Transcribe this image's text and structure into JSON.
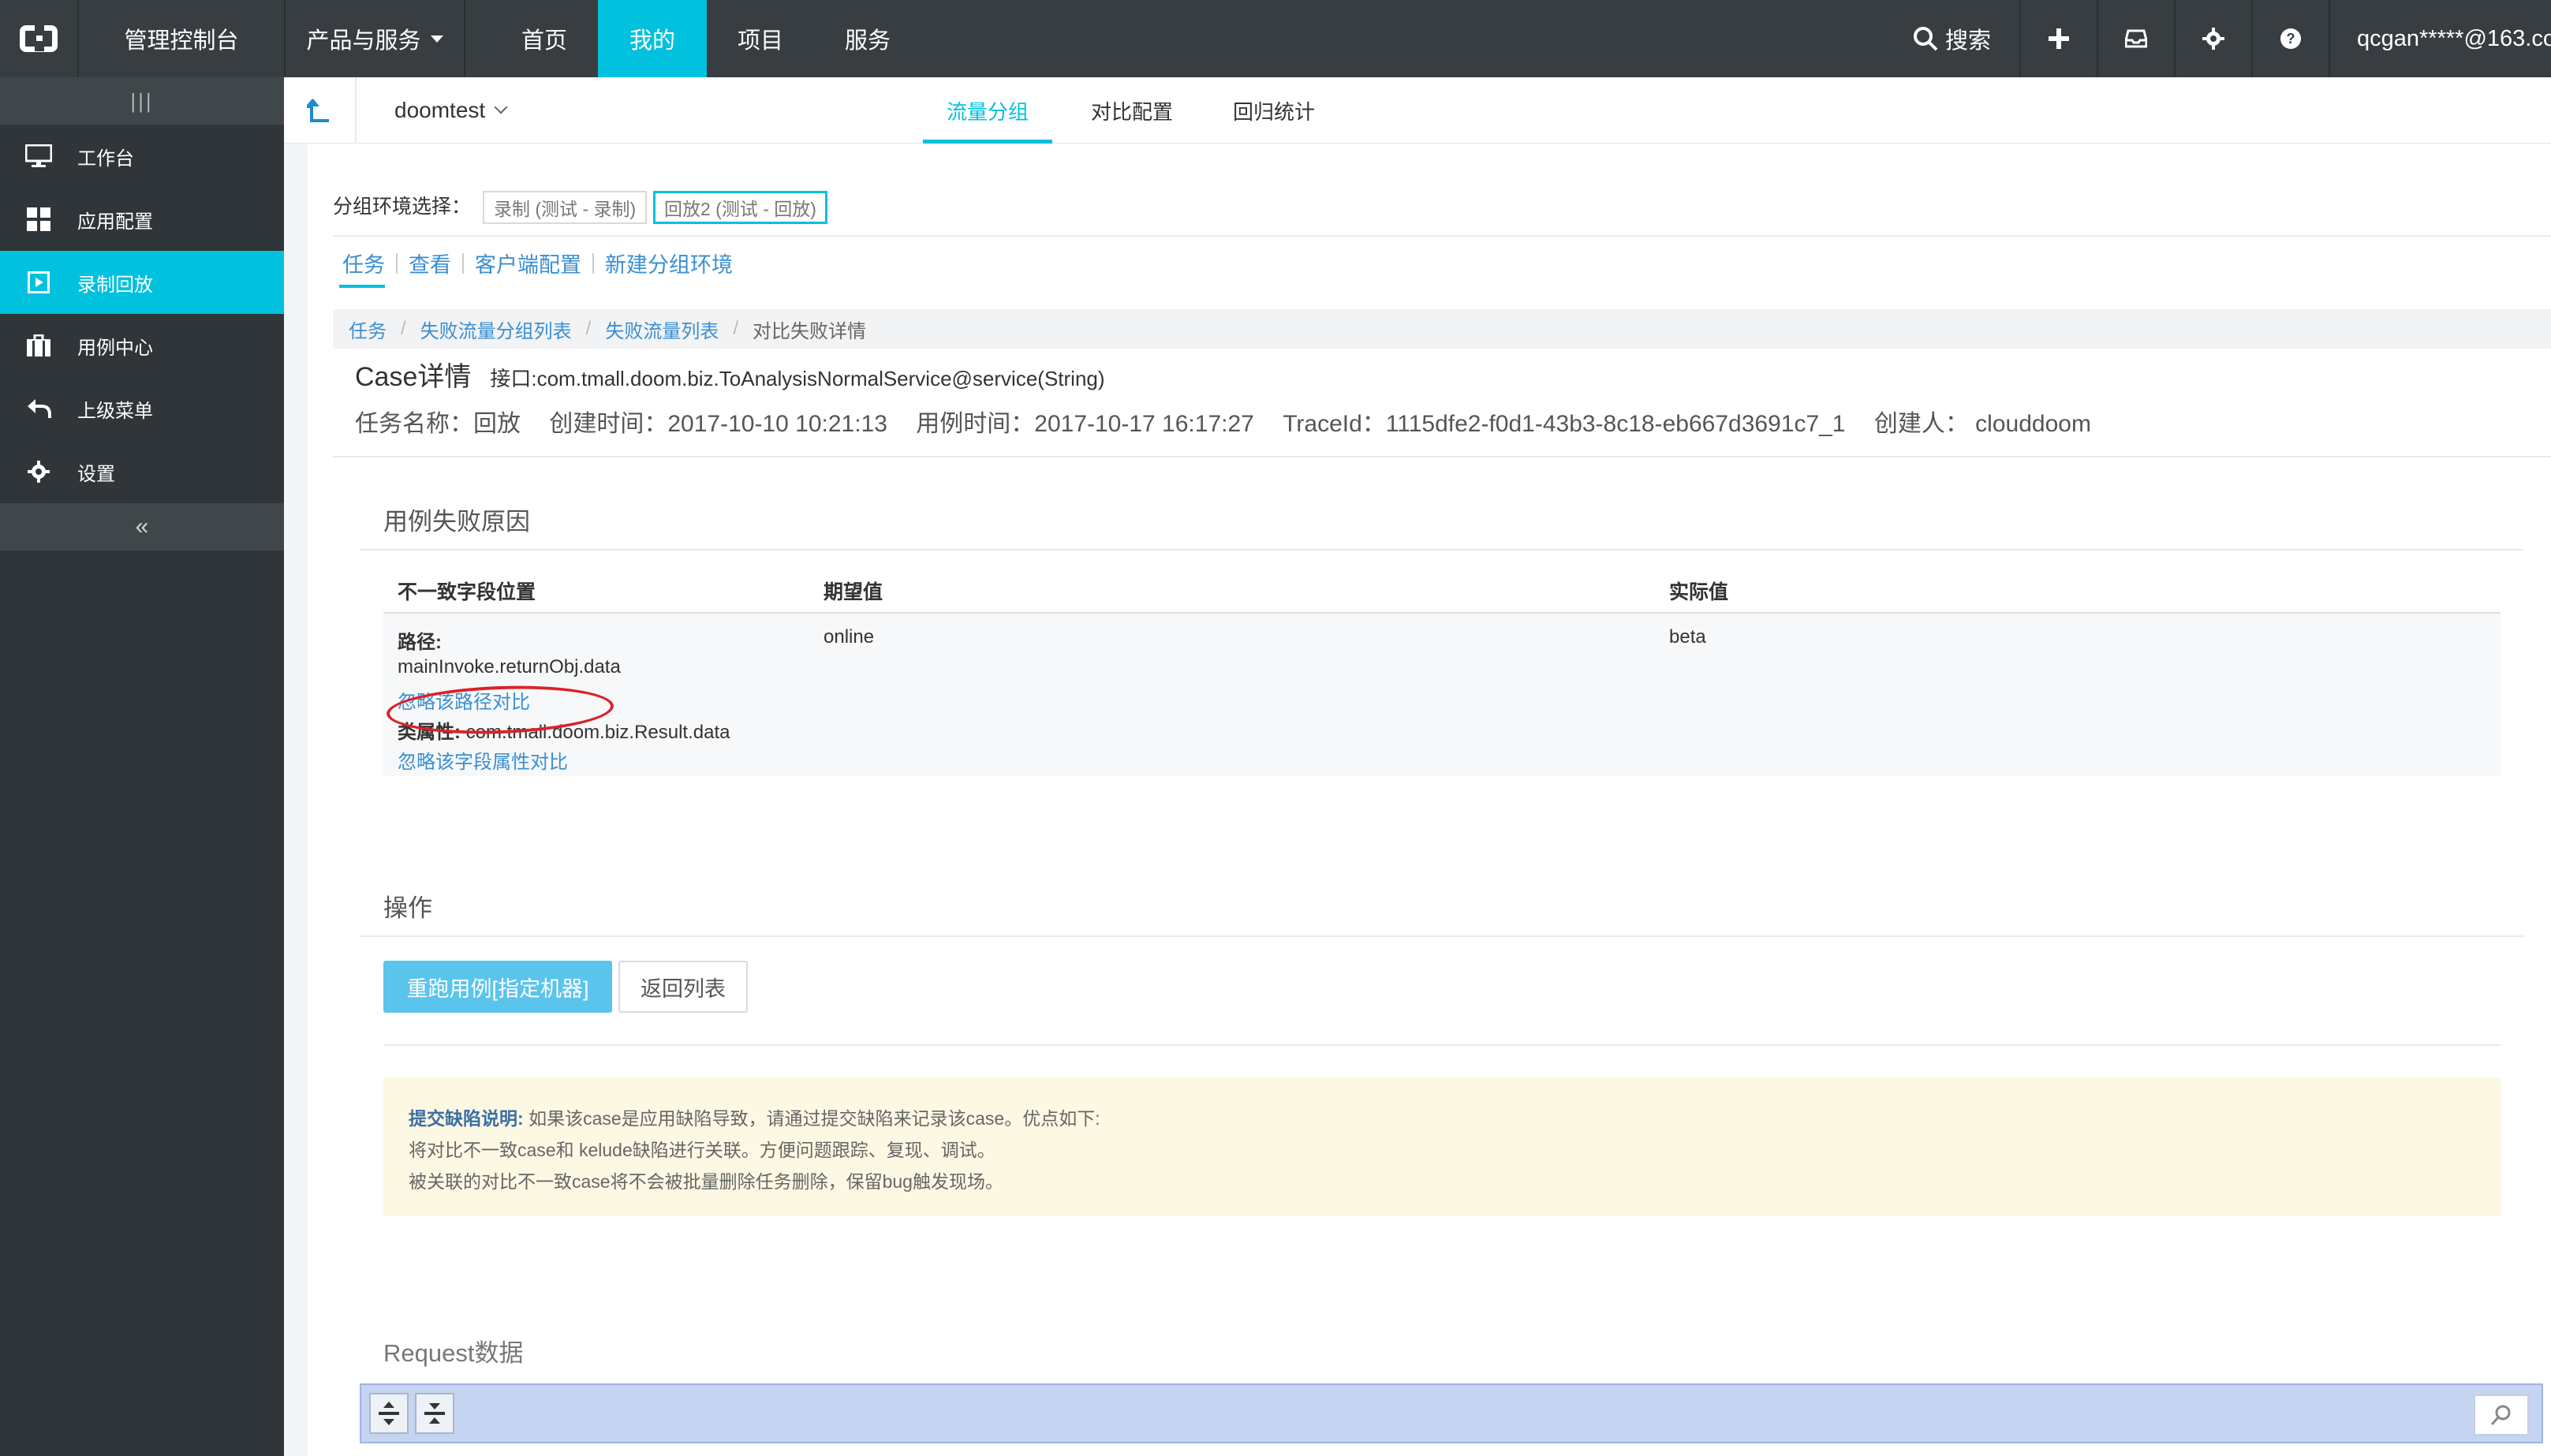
{
  "topbar": {
    "console": "管理控制台",
    "products": "产品与服务",
    "nav": [
      "首页",
      "我的",
      "项目",
      "服务"
    ],
    "search": "搜索",
    "user": "qcgan*****@163.co",
    "accent": "#00c1de",
    "bg": "#373d41"
  },
  "sidebar": {
    "items": [
      {
        "label": "工作台",
        "icon": "monitor-icon"
      },
      {
        "label": "应用配置",
        "icon": "grid-icon"
      },
      {
        "label": "录制回放",
        "icon": "play-icon"
      },
      {
        "label": "用例中心",
        "icon": "briefcase-icon"
      },
      {
        "label": "上级菜单",
        "icon": "back-arrow-icon"
      },
      {
        "label": "设置",
        "icon": "gear-icon"
      }
    ],
    "active_index": 2
  },
  "subheader": {
    "project": "doomtest",
    "tabs": [
      "流量分组",
      "对比配置",
      "回归统计"
    ]
  },
  "env": {
    "label": "分组环境选择：",
    "options": [
      "录制 (测试 - 录制)",
      "回放2 (测试 - 回放)"
    ],
    "selected": "回放2 (测试 - 回放)"
  },
  "tablinks": [
    "任务",
    "查看",
    "客户端配置",
    "新建分组环境"
  ],
  "breadcrumb": [
    "任务",
    "失败流量分组列表",
    "失败流量列表",
    "对比失败详情"
  ],
  "case": {
    "title": "Case详情",
    "interface": "接口:com.tmall.doom.biz.ToAnalysisNormalService@service(String)",
    "task_name": "任务名称：回放",
    "created": "创建时间：2017-10-10 10:21:13",
    "case_time": "用例时间：2017-10-17 16:17:27",
    "trace": "TraceId：1115dfe2-f0d1-43b3-8c18-eb667d3691c7_1",
    "creator": "创建人： clouddoom"
  },
  "failure": {
    "section_title": "用例失败原因",
    "headers": [
      "不一致字段位置",
      "期望值",
      "实际值"
    ],
    "path_label": "路径:",
    "path_value": "mainInvoke.returnObj.data",
    "ignore_path": "忽略该路径对比",
    "class_label": "类属性:",
    "class_value": "com.tmall.doom.biz.Result.data",
    "ignore_field": "忽略该字段属性对比",
    "expected": "online",
    "actual": "beta"
  },
  "ops": {
    "section_title": "操作",
    "rerun": "重跑用例[指定机器]",
    "back": "返回列表"
  },
  "notice": {
    "title": "提交缺陷说明:",
    "line1": "如果该case是应用缺陷导致，请通过提交缺陷来记录该case。优点如下:",
    "line2": "将对比不一致case和 kelude缺陷进行关联。方便问题跟踪、复现、调试。",
    "line3": "被关联的对比不一致case将不会被批量删除任务删除，保留bug触发现场。"
  },
  "request": {
    "section_title": "Request数据"
  }
}
